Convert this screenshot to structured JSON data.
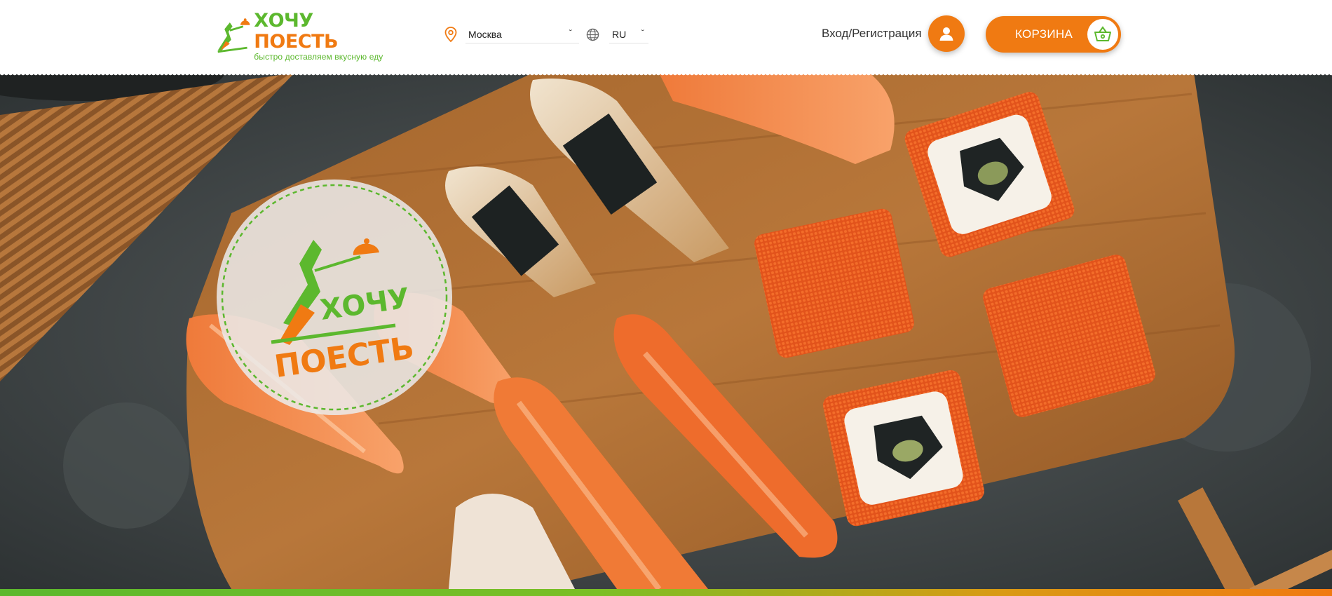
{
  "brand": {
    "name_part1": "ХОЧУ",
    "name_part2": "ПОЕСТЬ",
    "tagline": "быстро доставляем вкусную еду",
    "badge_line1": "ХОЧУ",
    "badge_line2": "ПОЕСТЬ",
    "green": "#5cb82e",
    "orange": "#f07a12"
  },
  "header": {
    "city": {
      "icon": "map-pin-icon",
      "value": "Москва",
      "chevron": "˘"
    },
    "language": {
      "icon": "globe-icon",
      "value": "RU",
      "chevron": "˘"
    },
    "login": {
      "label": "Вход/Регистрация",
      "icon": "user-icon"
    },
    "cart": {
      "label": "КОРЗИНА",
      "icon": "basket-icon"
    }
  },
  "hero": {
    "image": "sushi-board-photo"
  }
}
